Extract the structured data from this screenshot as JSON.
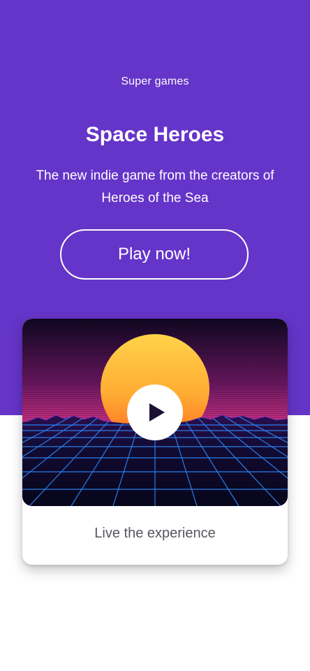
{
  "hero": {
    "eyebrow": "Super games",
    "title": "Space Heroes",
    "subtitle": "The new indie game from the creators of Heroes of the Sea",
    "cta_label": "Play now!"
  },
  "video_card": {
    "caption": "Live the experience",
    "play_icon": "play-icon"
  },
  "colors": {
    "brand_purple": "#6534c8",
    "white": "#ffffff",
    "caption_gray": "#555560",
    "sun_top": "#ffd34a",
    "sun_bottom": "#ff7a1a",
    "sky_pink": "#e0368a",
    "grid_blue": "#2e8bff"
  }
}
